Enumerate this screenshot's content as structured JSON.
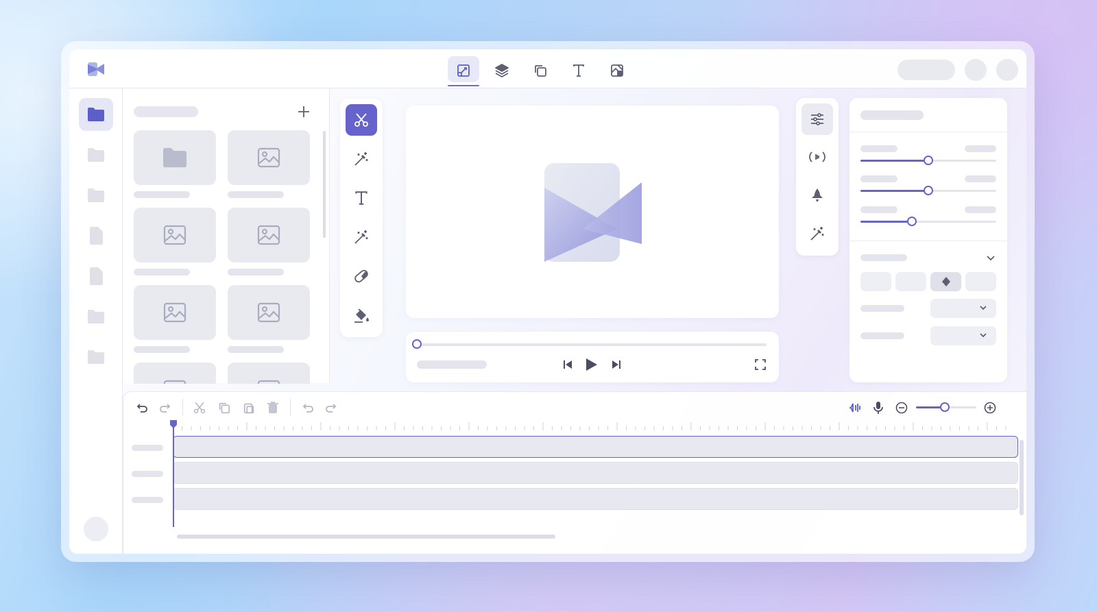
{
  "topbar": {
    "tabs": [
      {
        "name": "edit-tab",
        "icon": "edit-canvas-icon",
        "active": true
      },
      {
        "name": "layers-tab",
        "icon": "layers-icon",
        "active": false
      },
      {
        "name": "duplicate-tab",
        "icon": "copy-icon",
        "active": false
      },
      {
        "name": "text-tab",
        "icon": "text-icon",
        "active": false
      },
      {
        "name": "transform-tab",
        "icon": "crop-transform-icon",
        "active": false
      }
    ]
  },
  "sidebar": {
    "items": [
      {
        "icon": "folder-icon",
        "active": true
      },
      {
        "icon": "folder-icon",
        "active": false
      },
      {
        "icon": "folder-icon",
        "active": false
      },
      {
        "icon": "file-icon",
        "active": false
      },
      {
        "icon": "file-icon",
        "active": false
      },
      {
        "icon": "folder-icon",
        "active": false
      },
      {
        "icon": "folder-icon",
        "active": false
      }
    ]
  },
  "media": {
    "add_icon": "plus-icon",
    "thumbnails": [
      "folder-icon",
      "image-icon",
      "image-icon",
      "image-icon",
      "image-icon",
      "image-icon",
      "image-icon",
      "image-icon"
    ]
  },
  "tools": [
    "scissors-icon",
    "magic-wand-icon",
    "text-icon",
    "magic-wand-icon",
    "eraser-icon",
    "paint-bucket-icon"
  ],
  "effects": [
    "sliders-icon",
    "broadcast-icon",
    "audio-bell-icon",
    "magic-wand-icon"
  ],
  "player": {
    "progress": 0,
    "controls": [
      "skip-back-icon",
      "play-icon",
      "skip-forward-icon",
      "fullscreen-icon"
    ]
  },
  "properties": {
    "sliders": [
      {
        "value": 0.5
      },
      {
        "value": 0.5
      },
      {
        "value": 0.38
      }
    ],
    "segments": 4,
    "active_segment": 2
  },
  "timeline": {
    "zoom": 0.48,
    "tracks": 3,
    "colors": {
      "accent": "#6664cc",
      "track": "#e8e9f0"
    }
  }
}
